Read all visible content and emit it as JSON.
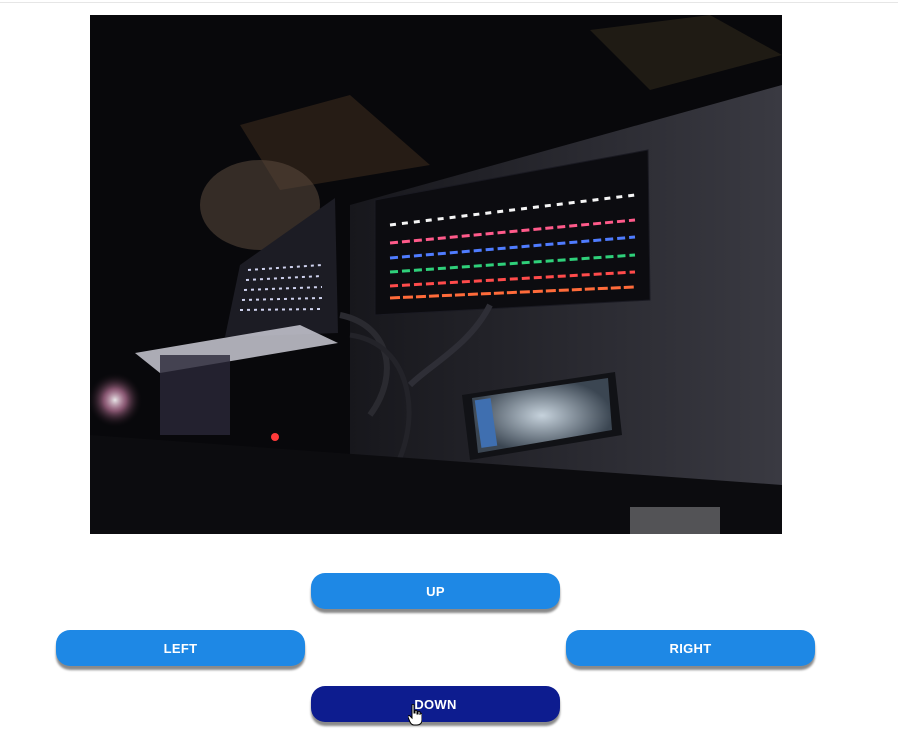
{
  "camera_feed": {
    "icon": "camera-stream"
  },
  "controls": {
    "up_label": "UP",
    "left_label": "LEFT",
    "right_label": "RIGHT",
    "down_label": "DOWN",
    "pressed": "DOWN",
    "button_color": "#1e88e5",
    "pressed_color": "#0d1c8f"
  }
}
